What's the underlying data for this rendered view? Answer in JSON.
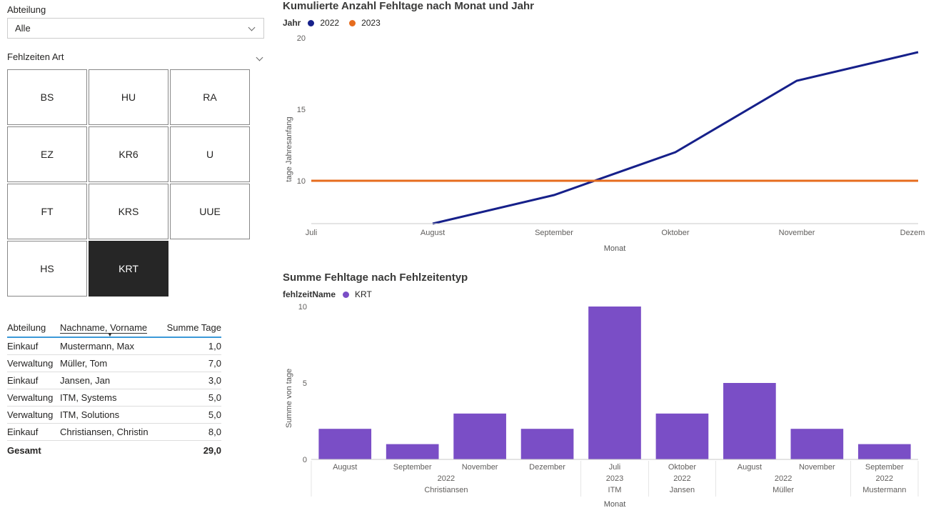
{
  "filters": {
    "abteilung_label": "Abteilung",
    "abteilung_value": "Alle",
    "fehlzeiten_label": "Fehlzeiten Art",
    "tiles": [
      "BS",
      "HU",
      "RA",
      "EZ",
      "KR6",
      "U",
      "FT",
      "KRS",
      "UUE",
      "HS",
      "KRT"
    ],
    "selected_tile": "KRT"
  },
  "table": {
    "col1": "Abteilung",
    "col2": "Nachname, Vorname",
    "col3": "Summe Tage",
    "rows": [
      {
        "a": "Einkauf",
        "n": "Mustermann, Max",
        "s": "1,0"
      },
      {
        "a": "Verwaltung",
        "n": "Müller, Tom",
        "s": "7,0"
      },
      {
        "a": "Einkauf",
        "n": "Jansen, Jan",
        "s": "3,0"
      },
      {
        "a": "Verwaltung",
        "n": "ITM, Systems",
        "s": "5,0"
      },
      {
        "a": "Verwaltung",
        "n": "ITM, Solutions",
        "s": "5,0"
      },
      {
        "a": "Einkauf",
        "n": "Christiansen, Christin",
        "s": "8,0"
      }
    ],
    "total_label": "Gesamt",
    "total_value": "29,0"
  },
  "chart1": {
    "title": "Kumulierte Anzahl Fehltage nach Monat und Jahr",
    "legend_label": "Jahr",
    "series_names": [
      "2022",
      "2023"
    ],
    "colors": {
      "2022": "#16208a",
      "2023": "#e66c1e"
    },
    "ylabel": "tage Jahresanfang",
    "xlabel": "Monat"
  },
  "chart2": {
    "title": "Summe Fehltage nach Fehlzeitentyp",
    "legend_label": "fehlzeitName",
    "series_name": "KRT",
    "color": "#7a4ec6",
    "ylabel": "Summe von tage",
    "xlabel": "Monat"
  },
  "chart_data": [
    {
      "type": "line",
      "title": "Kumulierte Anzahl Fehltage nach Monat und Jahr",
      "xlabel": "Monat",
      "ylabel": "tage Jahresanfang",
      "ylim": [
        7,
        20
      ],
      "categories": [
        "Juli",
        "August",
        "September",
        "Oktober",
        "November",
        "Dezember"
      ],
      "series": [
        {
          "name": "2022",
          "values": [
            null,
            7,
            9,
            12,
            17,
            19
          ]
        },
        {
          "name": "2023",
          "values": [
            10,
            10,
            10,
            10,
            10,
            10
          ]
        }
      ]
    },
    {
      "type": "bar",
      "title": "Summe Fehltage nach Fehlzeitentyp",
      "xlabel": "Monat",
      "ylabel": "Summe von tage",
      "ylim": [
        0,
        10
      ],
      "groups": [
        {
          "group": "Christiansen",
          "year": "2022",
          "bars": [
            {
              "month": "August",
              "value": 2
            },
            {
              "month": "September",
              "value": 1
            },
            {
              "month": "November",
              "value": 3
            },
            {
              "month": "Dezember",
              "value": 2
            }
          ]
        },
        {
          "group": "ITM",
          "year": "2023",
          "bars": [
            {
              "month": "Juli",
              "value": 10
            }
          ]
        },
        {
          "group": "Jansen",
          "year": "2022",
          "bars": [
            {
              "month": "Oktober",
              "value": 3
            }
          ]
        },
        {
          "group": "Müller",
          "year": "2022",
          "bars": [
            {
              "month": "August",
              "value": 5
            },
            {
              "month": "November",
              "value": 2
            }
          ]
        },
        {
          "group": "Mustermann",
          "year": "2022",
          "bars": [
            {
              "month": "September",
              "value": 1
            }
          ]
        }
      ],
      "series": [
        {
          "name": "KRT"
        }
      ]
    }
  ]
}
